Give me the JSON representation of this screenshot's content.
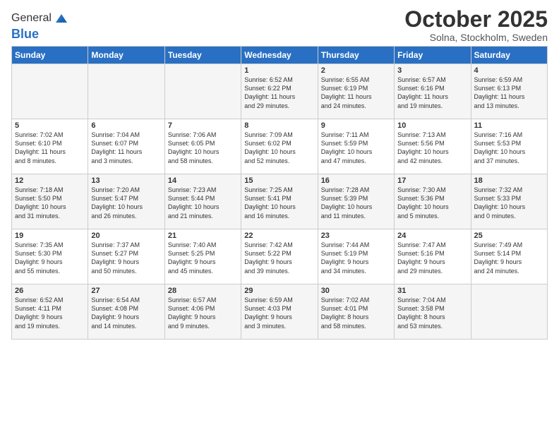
{
  "logo": {
    "general": "General",
    "blue": "Blue"
  },
  "title": "October 2025",
  "location": "Solna, Stockholm, Sweden",
  "days_of_week": [
    "Sunday",
    "Monday",
    "Tuesday",
    "Wednesday",
    "Thursday",
    "Friday",
    "Saturday"
  ],
  "weeks": [
    [
      {
        "day": "",
        "info": ""
      },
      {
        "day": "",
        "info": ""
      },
      {
        "day": "",
        "info": ""
      },
      {
        "day": "1",
        "info": "Sunrise: 6:52 AM\nSunset: 6:22 PM\nDaylight: 11 hours\nand 29 minutes."
      },
      {
        "day": "2",
        "info": "Sunrise: 6:55 AM\nSunset: 6:19 PM\nDaylight: 11 hours\nand 24 minutes."
      },
      {
        "day": "3",
        "info": "Sunrise: 6:57 AM\nSunset: 6:16 PM\nDaylight: 11 hours\nand 19 minutes."
      },
      {
        "day": "4",
        "info": "Sunrise: 6:59 AM\nSunset: 6:13 PM\nDaylight: 11 hours\nand 13 minutes."
      }
    ],
    [
      {
        "day": "5",
        "info": "Sunrise: 7:02 AM\nSunset: 6:10 PM\nDaylight: 11 hours\nand 8 minutes."
      },
      {
        "day": "6",
        "info": "Sunrise: 7:04 AM\nSunset: 6:07 PM\nDaylight: 11 hours\nand 3 minutes."
      },
      {
        "day": "7",
        "info": "Sunrise: 7:06 AM\nSunset: 6:05 PM\nDaylight: 10 hours\nand 58 minutes."
      },
      {
        "day": "8",
        "info": "Sunrise: 7:09 AM\nSunset: 6:02 PM\nDaylight: 10 hours\nand 52 minutes."
      },
      {
        "day": "9",
        "info": "Sunrise: 7:11 AM\nSunset: 5:59 PM\nDaylight: 10 hours\nand 47 minutes."
      },
      {
        "day": "10",
        "info": "Sunrise: 7:13 AM\nSunset: 5:56 PM\nDaylight: 10 hours\nand 42 minutes."
      },
      {
        "day": "11",
        "info": "Sunrise: 7:16 AM\nSunset: 5:53 PM\nDaylight: 10 hours\nand 37 minutes."
      }
    ],
    [
      {
        "day": "12",
        "info": "Sunrise: 7:18 AM\nSunset: 5:50 PM\nDaylight: 10 hours\nand 31 minutes."
      },
      {
        "day": "13",
        "info": "Sunrise: 7:20 AM\nSunset: 5:47 PM\nDaylight: 10 hours\nand 26 minutes."
      },
      {
        "day": "14",
        "info": "Sunrise: 7:23 AM\nSunset: 5:44 PM\nDaylight: 10 hours\nand 21 minutes."
      },
      {
        "day": "15",
        "info": "Sunrise: 7:25 AM\nSunset: 5:41 PM\nDaylight: 10 hours\nand 16 minutes."
      },
      {
        "day": "16",
        "info": "Sunrise: 7:28 AM\nSunset: 5:39 PM\nDaylight: 10 hours\nand 11 minutes."
      },
      {
        "day": "17",
        "info": "Sunrise: 7:30 AM\nSunset: 5:36 PM\nDaylight: 10 hours\nand 5 minutes."
      },
      {
        "day": "18",
        "info": "Sunrise: 7:32 AM\nSunset: 5:33 PM\nDaylight: 10 hours\nand 0 minutes."
      }
    ],
    [
      {
        "day": "19",
        "info": "Sunrise: 7:35 AM\nSunset: 5:30 PM\nDaylight: 9 hours\nand 55 minutes."
      },
      {
        "day": "20",
        "info": "Sunrise: 7:37 AM\nSunset: 5:27 PM\nDaylight: 9 hours\nand 50 minutes."
      },
      {
        "day": "21",
        "info": "Sunrise: 7:40 AM\nSunset: 5:25 PM\nDaylight: 9 hours\nand 45 minutes."
      },
      {
        "day": "22",
        "info": "Sunrise: 7:42 AM\nSunset: 5:22 PM\nDaylight: 9 hours\nand 39 minutes."
      },
      {
        "day": "23",
        "info": "Sunrise: 7:44 AM\nSunset: 5:19 PM\nDaylight: 9 hours\nand 34 minutes."
      },
      {
        "day": "24",
        "info": "Sunrise: 7:47 AM\nSunset: 5:16 PM\nDaylight: 9 hours\nand 29 minutes."
      },
      {
        "day": "25",
        "info": "Sunrise: 7:49 AM\nSunset: 5:14 PM\nDaylight: 9 hours\nand 24 minutes."
      }
    ],
    [
      {
        "day": "26",
        "info": "Sunrise: 6:52 AM\nSunset: 4:11 PM\nDaylight: 9 hours\nand 19 minutes."
      },
      {
        "day": "27",
        "info": "Sunrise: 6:54 AM\nSunset: 4:08 PM\nDaylight: 9 hours\nand 14 minutes."
      },
      {
        "day": "28",
        "info": "Sunrise: 6:57 AM\nSunset: 4:06 PM\nDaylight: 9 hours\nand 9 minutes."
      },
      {
        "day": "29",
        "info": "Sunrise: 6:59 AM\nSunset: 4:03 PM\nDaylight: 9 hours\nand 3 minutes."
      },
      {
        "day": "30",
        "info": "Sunrise: 7:02 AM\nSunset: 4:01 PM\nDaylight: 8 hours\nand 58 minutes."
      },
      {
        "day": "31",
        "info": "Sunrise: 7:04 AM\nSunset: 3:58 PM\nDaylight: 8 hours\nand 53 minutes."
      },
      {
        "day": "",
        "info": ""
      }
    ]
  ]
}
